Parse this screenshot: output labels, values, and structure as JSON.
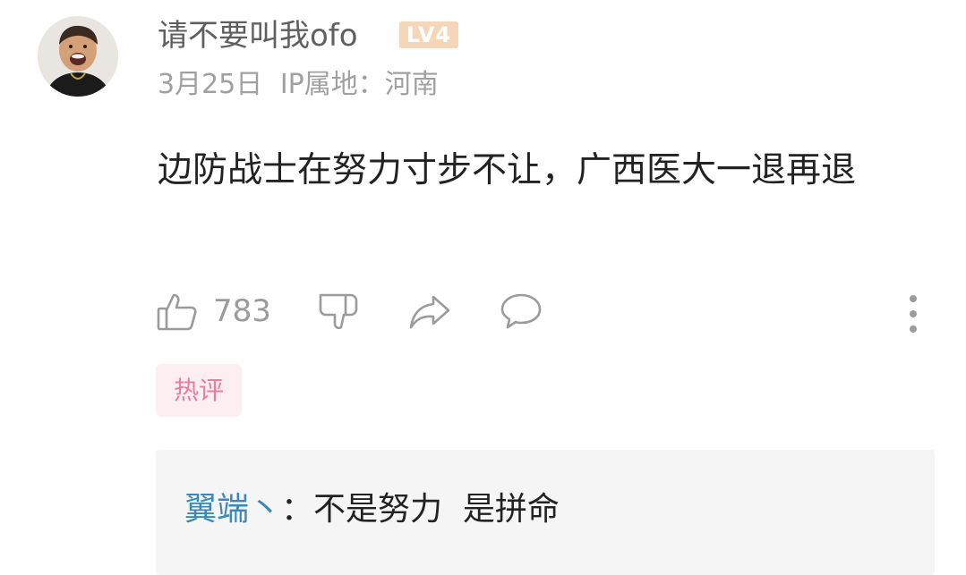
{
  "comment": {
    "username": "请不要叫我ofo",
    "level": "LV4",
    "date": "3月25日",
    "ip_location": "IP属地：河南",
    "text": "边防战士在努力寸步不让，广西医大一退再退",
    "like_count": "783"
  },
  "tag": {
    "label": "热评"
  },
  "reply": {
    "user": "翼端丶",
    "separator": "：",
    "text": "不是努力  是拼命"
  },
  "colors": {
    "reply_user": "#3d87b7",
    "hot_tag_text": "#e97da0",
    "hot_tag_bg": "#fdeef2",
    "level_badge": "#f6d6b8"
  },
  "icons": [
    "thumbs-up-icon",
    "thumbs-down-icon",
    "share-icon",
    "comment-icon",
    "more-icon"
  ]
}
